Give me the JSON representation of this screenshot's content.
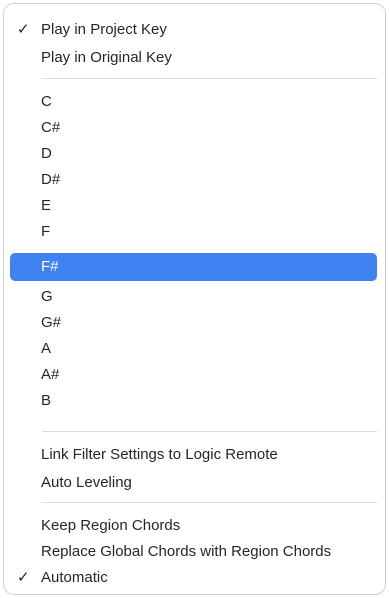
{
  "menu": {
    "sections": [
      {
        "items": [
          {
            "label": "Play in Project Key",
            "checked": true
          },
          {
            "label": "Play in Original Key",
            "checked": false
          }
        ]
      },
      {
        "items": [
          {
            "label": "C",
            "checked": false
          },
          {
            "label": "C#",
            "checked": false
          },
          {
            "label": "D",
            "checked": false
          },
          {
            "label": "D#",
            "checked": false
          },
          {
            "label": "E",
            "checked": false
          },
          {
            "label": "F",
            "checked": false
          },
          {
            "label": "F#",
            "checked": false,
            "highlighted": true
          },
          {
            "label": "G",
            "checked": false
          },
          {
            "label": "G#",
            "checked": false
          },
          {
            "label": "A",
            "checked": false
          },
          {
            "label": "A#",
            "checked": false
          },
          {
            "label": "B",
            "checked": false
          }
        ]
      },
      {
        "items": [
          {
            "label": "Link Filter Settings to Logic Remote",
            "checked": false
          },
          {
            "label": "Auto Leveling",
            "checked": false
          }
        ]
      },
      {
        "items": [
          {
            "label": "Keep Region Chords",
            "checked": false
          },
          {
            "label": "Replace Global Chords with Region Chords",
            "checked": false
          },
          {
            "label": "Automatic",
            "checked": true
          }
        ]
      }
    ],
    "checkmark_glyph": "✓",
    "colors": {
      "highlight": "#3f83f2",
      "text": "#262626",
      "separator": "#dcdcdc"
    }
  }
}
